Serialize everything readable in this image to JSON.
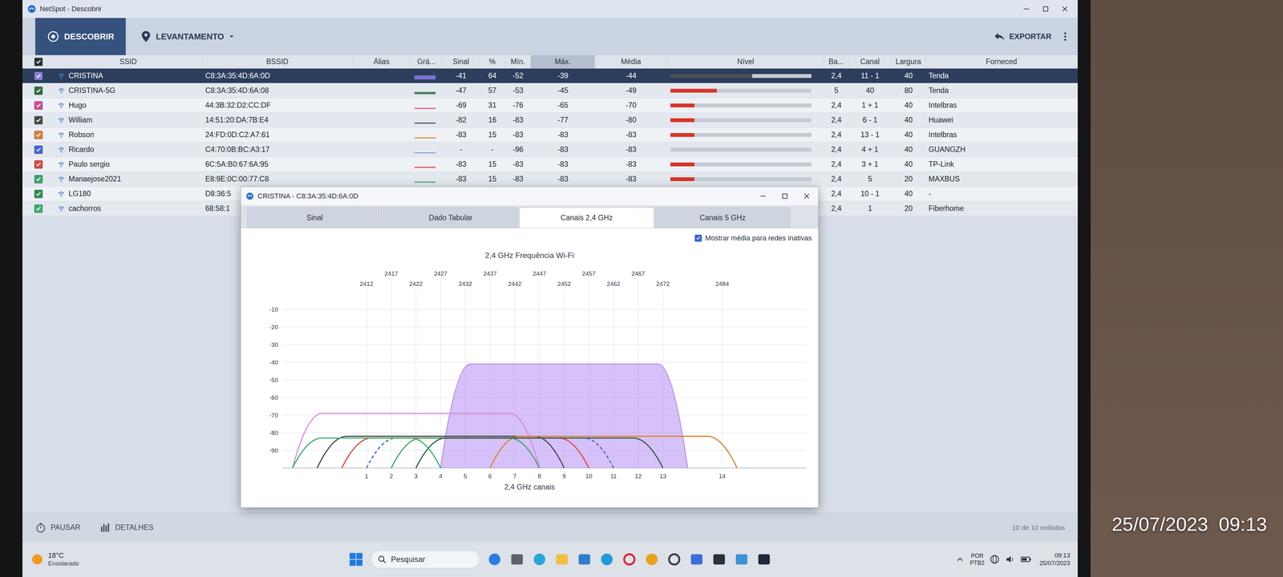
{
  "window": {
    "title": "NetSpot - Descobrir"
  },
  "toolbar": {
    "modes": [
      {
        "label": "DESCOBRIR",
        "selected": true
      },
      {
        "label": "LEVANTAMENTO",
        "selected": false
      }
    ],
    "export": "EXPORTAR"
  },
  "table": {
    "all_checked": true,
    "columns": [
      {
        "label": "SSID",
        "sorted": false
      },
      {
        "label": "BSSID",
        "sorted": false
      },
      {
        "label": "Álias",
        "sorted": false
      },
      {
        "label": "Grá...",
        "sorted": false
      },
      {
        "label": "Sinal",
        "sorted": false
      },
      {
        "label": "%",
        "sorted": false
      },
      {
        "label": "Mín.",
        "sorted": false
      },
      {
        "label": "Máx.",
        "sorted": true
      },
      {
        "label": "Média",
        "sorted": false
      },
      {
        "label": "Nível",
        "sorted": false
      },
      {
        "label": "Ba...",
        "sorted": false
      },
      {
        "label": "Canal",
        "sorted": false
      },
      {
        "label": "Largura",
        "sorted": false
      },
      {
        "label": "Forneced",
        "sorted": false
      }
    ],
    "rows": [
      {
        "selected": true,
        "checked": true,
        "color": "#8a7ae6",
        "ssid": "CRISTINA",
        "bssid": "C8:3A:35:4D:6A:0D",
        "alias": "",
        "signal": "-41",
        "percent": "64",
        "min": "-52",
        "max": "-39",
        "avg": "-44",
        "level": 0.58,
        "band": "2,4",
        "channel": "11 - 1",
        "width": "40",
        "vendor": "Tenda"
      },
      {
        "selected": false,
        "checked": true,
        "color": "#2f6e3c",
        "ssid": "CRISTINA-5G",
        "bssid": "C8:3A:35:4D:6A:08",
        "alias": "",
        "signal": "-47",
        "percent": "57",
        "min": "-53",
        "max": "-45",
        "avg": "-49",
        "level": 0.33,
        "band": "5",
        "channel": "40",
        "width": "80",
        "vendor": "Tenda"
      },
      {
        "selected": false,
        "checked": true,
        "color": "#d9478f",
        "ssid": "Hugo",
        "bssid": "44:3B:32:D2:CC:DF",
        "alias": "",
        "signal": "-69",
        "percent": "31",
        "min": "-76",
        "max": "-65",
        "avg": "-70",
        "level": 0.17,
        "band": "2,4",
        "channel": "1 + 1",
        "width": "40",
        "vendor": "Intelbras"
      },
      {
        "selected": false,
        "checked": true,
        "color": "#4a4a4a",
        "ssid": "William",
        "bssid": "14:51:20:DA:7B:E4",
        "alias": "",
        "signal": "-82",
        "percent": "16",
        "min": "-83",
        "max": "-77",
        "avg": "-80",
        "level": 0.17,
        "band": "2,4",
        "channel": "6 - 1",
        "width": "40",
        "vendor": "Huawei"
      },
      {
        "selected": false,
        "checked": true,
        "color": "#e0812e",
        "ssid": "Robson",
        "bssid": "24:FD:0D:C2:A7:61",
        "alias": "",
        "signal": "-83",
        "percent": "15",
        "min": "-83",
        "max": "-83",
        "avg": "-83",
        "level": 0.17,
        "band": "2,4",
        "channel": "13 - 1",
        "width": "40",
        "vendor": "Intelbras"
      },
      {
        "selected": false,
        "checked": true,
        "color": "#3f63d6",
        "ssid": "Ricardo",
        "bssid": "C4:70:0B:BC:A3:17",
        "alias": "",
        "signal": "-",
        "percent": "-",
        "min": "-96",
        "max": "-83",
        "avg": "-83",
        "level": 0,
        "band": "2,4",
        "channel": "4 + 1",
        "width": "40",
        "vendor": "GUANGZH"
      },
      {
        "selected": false,
        "checked": true,
        "color": "#e0483c",
        "ssid": "Paulo sergio",
        "bssid": "6C:5A:B0:67:6A:95",
        "alias": "",
        "signal": "-83",
        "percent": "15",
        "min": "-83",
        "max": "-83",
        "avg": "-83",
        "level": 0.17,
        "band": "2,4",
        "channel": "3 + 1",
        "width": "40",
        "vendor": "TP-Link"
      },
      {
        "selected": false,
        "checked": true,
        "color": "#3fa36a",
        "ssid": "Manaejose2021",
        "bssid": "E8:9E:0C:00:77:C8",
        "alias": "",
        "signal": "-83",
        "percent": "15",
        "min": "-83",
        "max": "-83",
        "avg": "-83",
        "level": 0.17,
        "band": "2,4",
        "channel": "5",
        "width": "20",
        "vendor": "MAXBUS"
      },
      {
        "selected": false,
        "checked": true,
        "color": "#2f8f4a",
        "ssid": "LG180",
        "bssid": "D8:36:5",
        "alias": "",
        "signal": "",
        "percent": "",
        "min": "",
        "max": "",
        "avg": "",
        "level": null,
        "band": "2,4",
        "channel": "10 - 1",
        "width": "40",
        "vendor": "-"
      },
      {
        "selected": false,
        "checked": true,
        "color": "#36b36a",
        "ssid": "cachorros",
        "bssid": "68:58:1",
        "alias": "",
        "signal": "",
        "percent": "",
        "min": "",
        "max": "",
        "avg": "",
        "level": null,
        "band": "2,4",
        "channel": "1",
        "width": "20",
        "vendor": "Fiberhome"
      }
    ]
  },
  "popup": {
    "title": "CRISTINA - C8:3A:35:4D:6A:0D",
    "tabs": [
      {
        "label": "Sinal",
        "selected": false
      },
      {
        "label": "Dado Tabular",
        "selected": false
      },
      {
        "label": "Canais 2,4 GHz",
        "selected": true
      },
      {
        "label": "Canais 5 GHz",
        "selected": false
      }
    ],
    "show_average": {
      "label": "Mostrar média para redes inativas",
      "checked": true
    },
    "chart": {
      "title": "2,4 GHz Frequência Wi-Fi",
      "freq_ticks_top": [
        "2417",
        "2427",
        "2437",
        "2447",
        "2457",
        "2467"
      ],
      "freq_ticks_bottom": [
        "2412",
        "2422",
        "2432",
        "2442",
        "2452",
        "2462",
        "2472",
        "2484"
      ],
      "y_ticks": [
        "-10",
        "-20",
        "-30",
        "-40",
        "-50",
        "-60",
        "-70",
        "-80",
        "-90"
      ],
      "x_ticks": [
        "1",
        "2",
        "3",
        "4",
        "5",
        "6",
        "7",
        "8",
        "9",
        "10",
        "11",
        "12",
        "13",
        "14"
      ],
      "x_label": "2,4 GHz canais",
      "series": [
        {
          "name": "CRISTINA",
          "color": "#b48ef2",
          "selected": true,
          "inactive": false,
          "mhz": [
            2432,
            2472
          ],
          "values": [
            -41
          ]
        },
        {
          "name": "Hugo",
          "color": "#d98ad6",
          "selected": false,
          "inactive": false,
          "mhz": [
            2402,
            2442
          ],
          "values": [
            -69
          ]
        },
        {
          "name": "William",
          "color": "#4a4a4a",
          "selected": false,
          "inactive": false,
          "mhz": [
            2407,
            2447
          ],
          "values": [
            -82
          ]
        },
        {
          "name": "Robson",
          "color": "#e0812e",
          "selected": false,
          "inactive": false,
          "mhz": [
            2442,
            2482
          ],
          "values": [
            -82
          ]
        },
        {
          "name": "Ricardo",
          "color": "#3f63d6",
          "selected": false,
          "inactive": true,
          "mhz": [
            2417,
            2457
          ],
          "values": [
            -83
          ]
        },
        {
          "name": "Paulo sergio",
          "color": "#e0483c",
          "selected": false,
          "inactive": false,
          "mhz": [
            2412,
            2452
          ],
          "values": [
            -83
          ]
        },
        {
          "name": "Manaejose2021",
          "color": "#3fa36a",
          "selected": false,
          "inactive": false,
          "mhz": [
            2422,
            2442
          ],
          "values": [
            -83
          ]
        },
        {
          "name": "LG180",
          "color": "#2f5f4a",
          "selected": false,
          "inactive": false,
          "mhz": [
            2427,
            2467
          ],
          "values": [
            -83
          ]
        },
        {
          "name": "cachorros",
          "color": "#36b36a",
          "selected": false,
          "inactive": false,
          "mhz": [
            2402,
            2422
          ],
          "values": [
            -83
          ]
        }
      ]
    }
  },
  "status_bar": {
    "pause": "PAUSAR",
    "details": "DETALHES",
    "count": "10 de 10 exibidas"
  },
  "taskbar": {
    "temperature": "18°C",
    "weather": "Ensolarado",
    "search": "Pesquisar",
    "language": "POR",
    "layout": "PTB2",
    "time": "09:13",
    "date": "25/07/2023"
  },
  "overlay": {
    "timestamp": "25/07/2023  09:13"
  }
}
